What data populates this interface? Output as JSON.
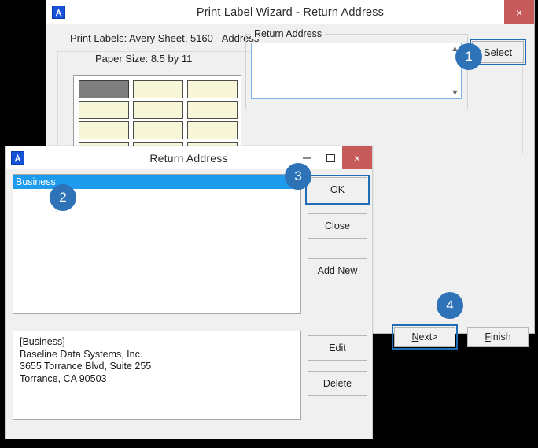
{
  "wizard": {
    "title": "Print Label Wizard - Return Address",
    "icon": "app-a-icon",
    "close_label": "×",
    "subtitle": "Print Labels: Avery Sheet, 5160 - Address",
    "paper_size_label": "Paper Size: 8.5 by 11",
    "label_sheet": {
      "columns": 3,
      "rows": 4,
      "selected_index": 0
    },
    "return_address_group": {
      "title": "Return Address",
      "value": "",
      "placeholder": "",
      "scroll_up_icon": "chevron-up-icon",
      "scroll_down_icon": "chevron-down-icon"
    },
    "select_button": "Select",
    "next_button_prefix": "N",
    "next_button_rest": "ext>",
    "finish_button_prefix": "F",
    "finish_button_rest": "inish"
  },
  "return_address_dialog": {
    "title": "Return Address",
    "icon": "app-a-icon",
    "minimize_label": "",
    "maximize_label": "",
    "close_label": "×",
    "list_items": [
      {
        "label": "Business",
        "selected": true
      }
    ],
    "detail_lines": [
      "[Business]",
      "Baseline Data Systems, Inc.",
      "3655 Torrance Blvd, Suite 255",
      "Torrance, CA 90503"
    ],
    "buttons": {
      "ok_prefix": "O",
      "ok_rest": "K",
      "close": "Close",
      "add_new": "Add New",
      "edit": "Edit",
      "delete": "Delete"
    }
  },
  "callouts": [
    {
      "number": "1"
    },
    {
      "number": "2"
    },
    {
      "number": "3"
    },
    {
      "number": "4"
    }
  ],
  "colors": {
    "accent_blue": "#2e73b8",
    "highlight_outline": "#1f6cb8",
    "selection_blue": "#1e9bec",
    "close_red": "#c75b5b",
    "label_cream": "#f7f6d8",
    "label_selected_gray": "#7e7e7e",
    "window_face": "#f0f0f0",
    "backdrop": "#000000"
  }
}
